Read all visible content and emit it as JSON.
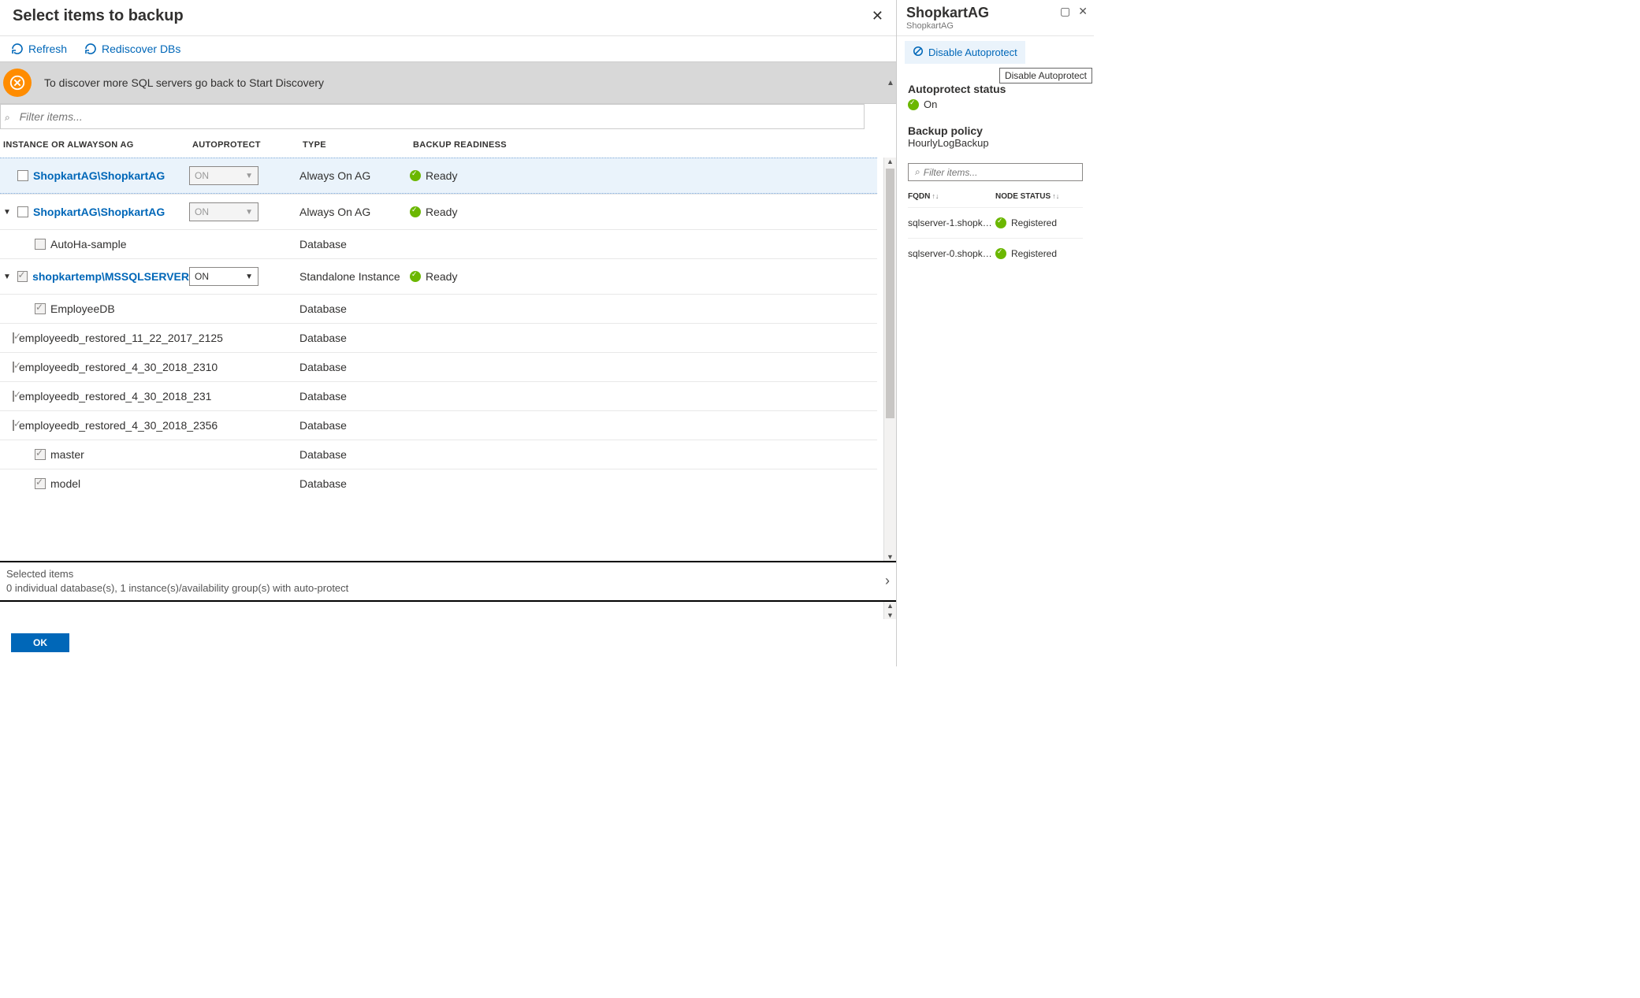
{
  "left": {
    "title": "Select items to backup",
    "refresh": "Refresh",
    "rediscover": "Rediscover DBs",
    "banner": "To discover more SQL servers go back to Start Discovery",
    "filter_placeholder": "Filter items...",
    "cols": {
      "c1": "INSTANCE OR ALWAYSON AG",
      "c2": "AUTOPROTECT",
      "c3": "TYPE",
      "c4": "BACKUP READINESS"
    },
    "rows": [
      {
        "caret": "",
        "chk": "empty",
        "name": "ShopkartAG\\ShopkartAG",
        "link": true,
        "ap": "ON",
        "apdis": true,
        "type": "Always On AG",
        "ready": "Ready",
        "selected": true
      },
      {
        "caret": "▼",
        "chk": "empty",
        "name": "ShopkartAG\\ShopkartAG",
        "link": true,
        "ap": "ON",
        "apdis": true,
        "type": "Always On AG",
        "ready": "Ready"
      },
      {
        "caret": "",
        "indent": true,
        "chk": "grey",
        "name": "AutoHa-sample",
        "link": false,
        "ap": "",
        "type": "Database",
        "ready": ""
      },
      {
        "caret": "▼",
        "chk": "greyTick",
        "name": "shopkartemp\\MSSQLSERVER",
        "link": true,
        "ap": "ON",
        "apdis": false,
        "type": "Standalone Instance",
        "ready": "Ready"
      },
      {
        "caret": "",
        "indent": true,
        "chk": "greyTick",
        "name": "EmployeeDB",
        "link": false,
        "ap": "",
        "type": "Database",
        "ready": ""
      },
      {
        "caret": "",
        "indent": true,
        "chk": "greyTick",
        "name": "employeedb_restored_11_22_2017_2125",
        "link": false,
        "ap": "",
        "type": "Database",
        "ready": ""
      },
      {
        "caret": "",
        "indent": true,
        "chk": "greyTick",
        "name": "employeedb_restored_4_30_2018_2310",
        "link": false,
        "ap": "",
        "type": "Database",
        "ready": ""
      },
      {
        "caret": "",
        "indent": true,
        "chk": "greyTick",
        "name": "employeedb_restored_4_30_2018_231",
        "link": false,
        "ap": "",
        "type": "Database",
        "ready": ""
      },
      {
        "caret": "",
        "indent": true,
        "chk": "greyTick",
        "name": "employeedb_restored_4_30_2018_2356",
        "link": false,
        "ap": "",
        "type": "Database",
        "ready": ""
      },
      {
        "caret": "",
        "indent": true,
        "chk": "greyTick",
        "name": "master",
        "link": false,
        "ap": "",
        "type": "Database",
        "ready": ""
      },
      {
        "caret": "",
        "indent": true,
        "chk": "greyTick",
        "name": "model",
        "link": false,
        "ap": "",
        "type": "Database",
        "ready": ""
      }
    ],
    "sel_title": "Selected items",
    "sel_summary": "0 individual database(s), 1 instance(s)/availability group(s) with auto-protect",
    "ok": "OK"
  },
  "right": {
    "title": "ShopkartAG",
    "subtitle": "ShopkartAG",
    "disable_label": "Disable Autoprotect",
    "tooltip": "Disable Autoprotect",
    "status_heading": "Autoprotect status",
    "status_value": "On",
    "policy_heading": "Backup policy",
    "policy_value": "HourlyLogBackup",
    "filter_placeholder": "Filter items...",
    "col_fqdn": "FQDN",
    "col_node": "NODE STATUS",
    "nodes": [
      {
        "fqdn": "sqlserver-1.shopkart.…",
        "status": "Registered"
      },
      {
        "fqdn": "sqlserver-0.shopkart.…",
        "status": "Registered"
      }
    ]
  }
}
